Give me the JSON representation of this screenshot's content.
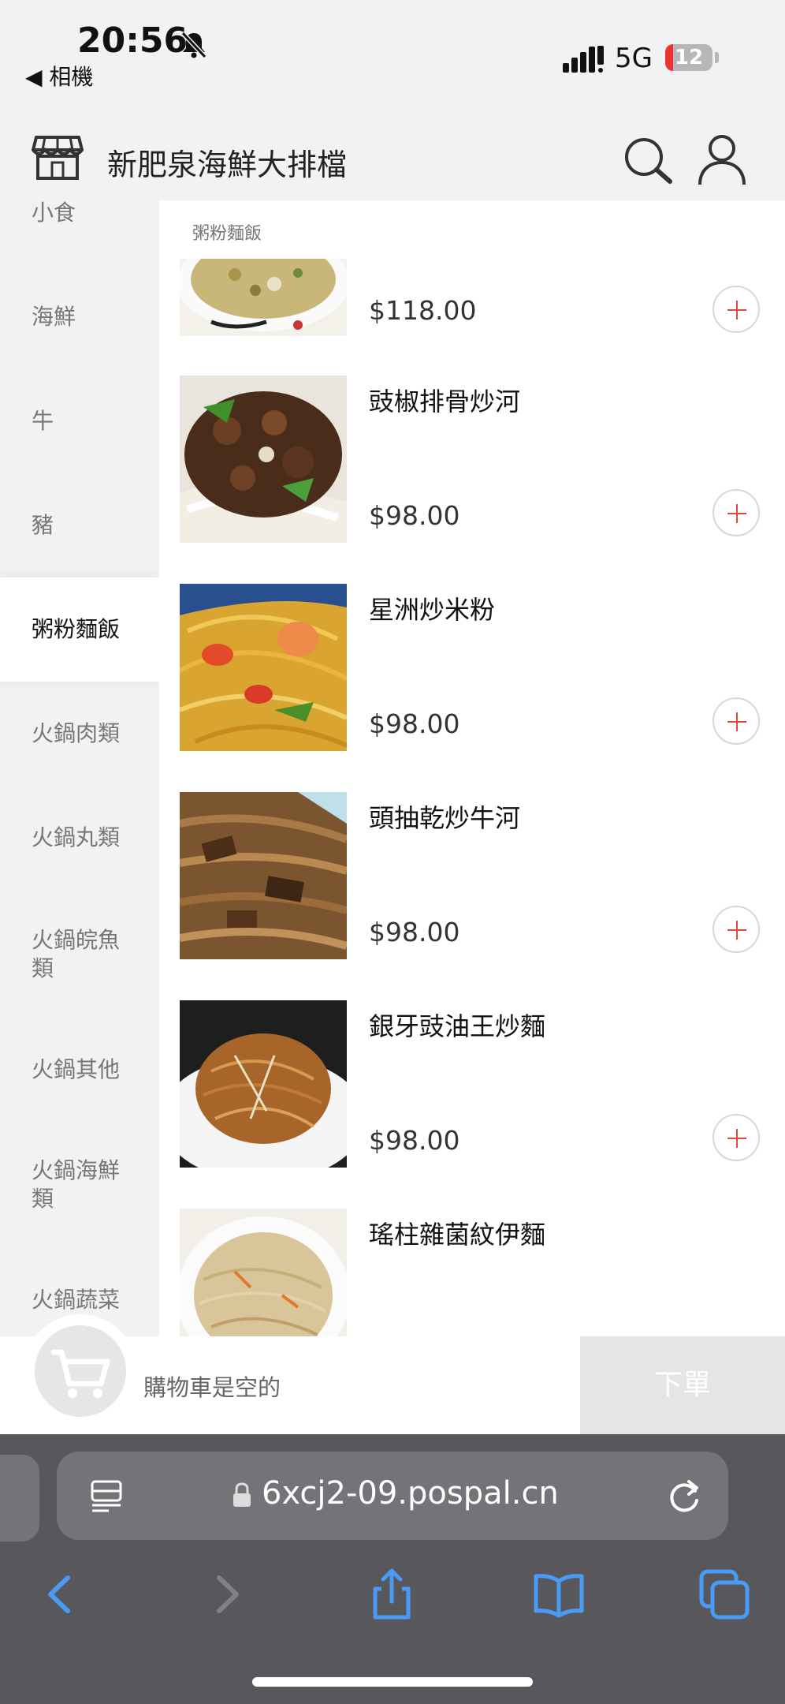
{
  "status_bar": {
    "time": "20:56",
    "back_label": "◀ 相機",
    "network": "5G",
    "battery_level": 12,
    "battery_label": "12"
  },
  "header": {
    "title": "新肥泉海鮮大排檔",
    "icons": [
      "store-icon",
      "search-icon",
      "user-icon"
    ]
  },
  "sidebar": {
    "categories": [
      "小食",
      "海鮮",
      "牛",
      "豬",
      "粥粉麵飯",
      "火鍋肉類",
      "火鍋丸類",
      "火鍋皖魚類",
      "火鍋其他",
      "火鍋海鮮類",
      "火鍋蔬菜"
    ],
    "active": "粥粉麵飯"
  },
  "content": {
    "section_label": "粥粉麵飯",
    "items": [
      {
        "name": "",
        "price": "$118.00"
      },
      {
        "name": "豉椒排骨炒河",
        "price": "$98.00"
      },
      {
        "name": "星洲炒米粉",
        "price": "$98.00"
      },
      {
        "name": "頭抽乾炒牛河",
        "price": "$98.00"
      },
      {
        "name": "銀牙豉油王炒麵",
        "price": "$98.00"
      },
      {
        "name": "瑤柱雜菌紋伊麵",
        "price": ""
      }
    ]
  },
  "cart": {
    "empty_text": "購物車是空的",
    "order_label": "下單"
  },
  "browser": {
    "url": "6xcj2-09.pospal.cn",
    "toolbar_icons": [
      "back-icon",
      "forward-icon",
      "share-icon",
      "bookmarks-icon",
      "tabs-icon"
    ]
  },
  "colors": {
    "accent": "#e24a3b",
    "browser_bg": "#58585c",
    "toolbar_blue": "#4a9bf5"
  }
}
